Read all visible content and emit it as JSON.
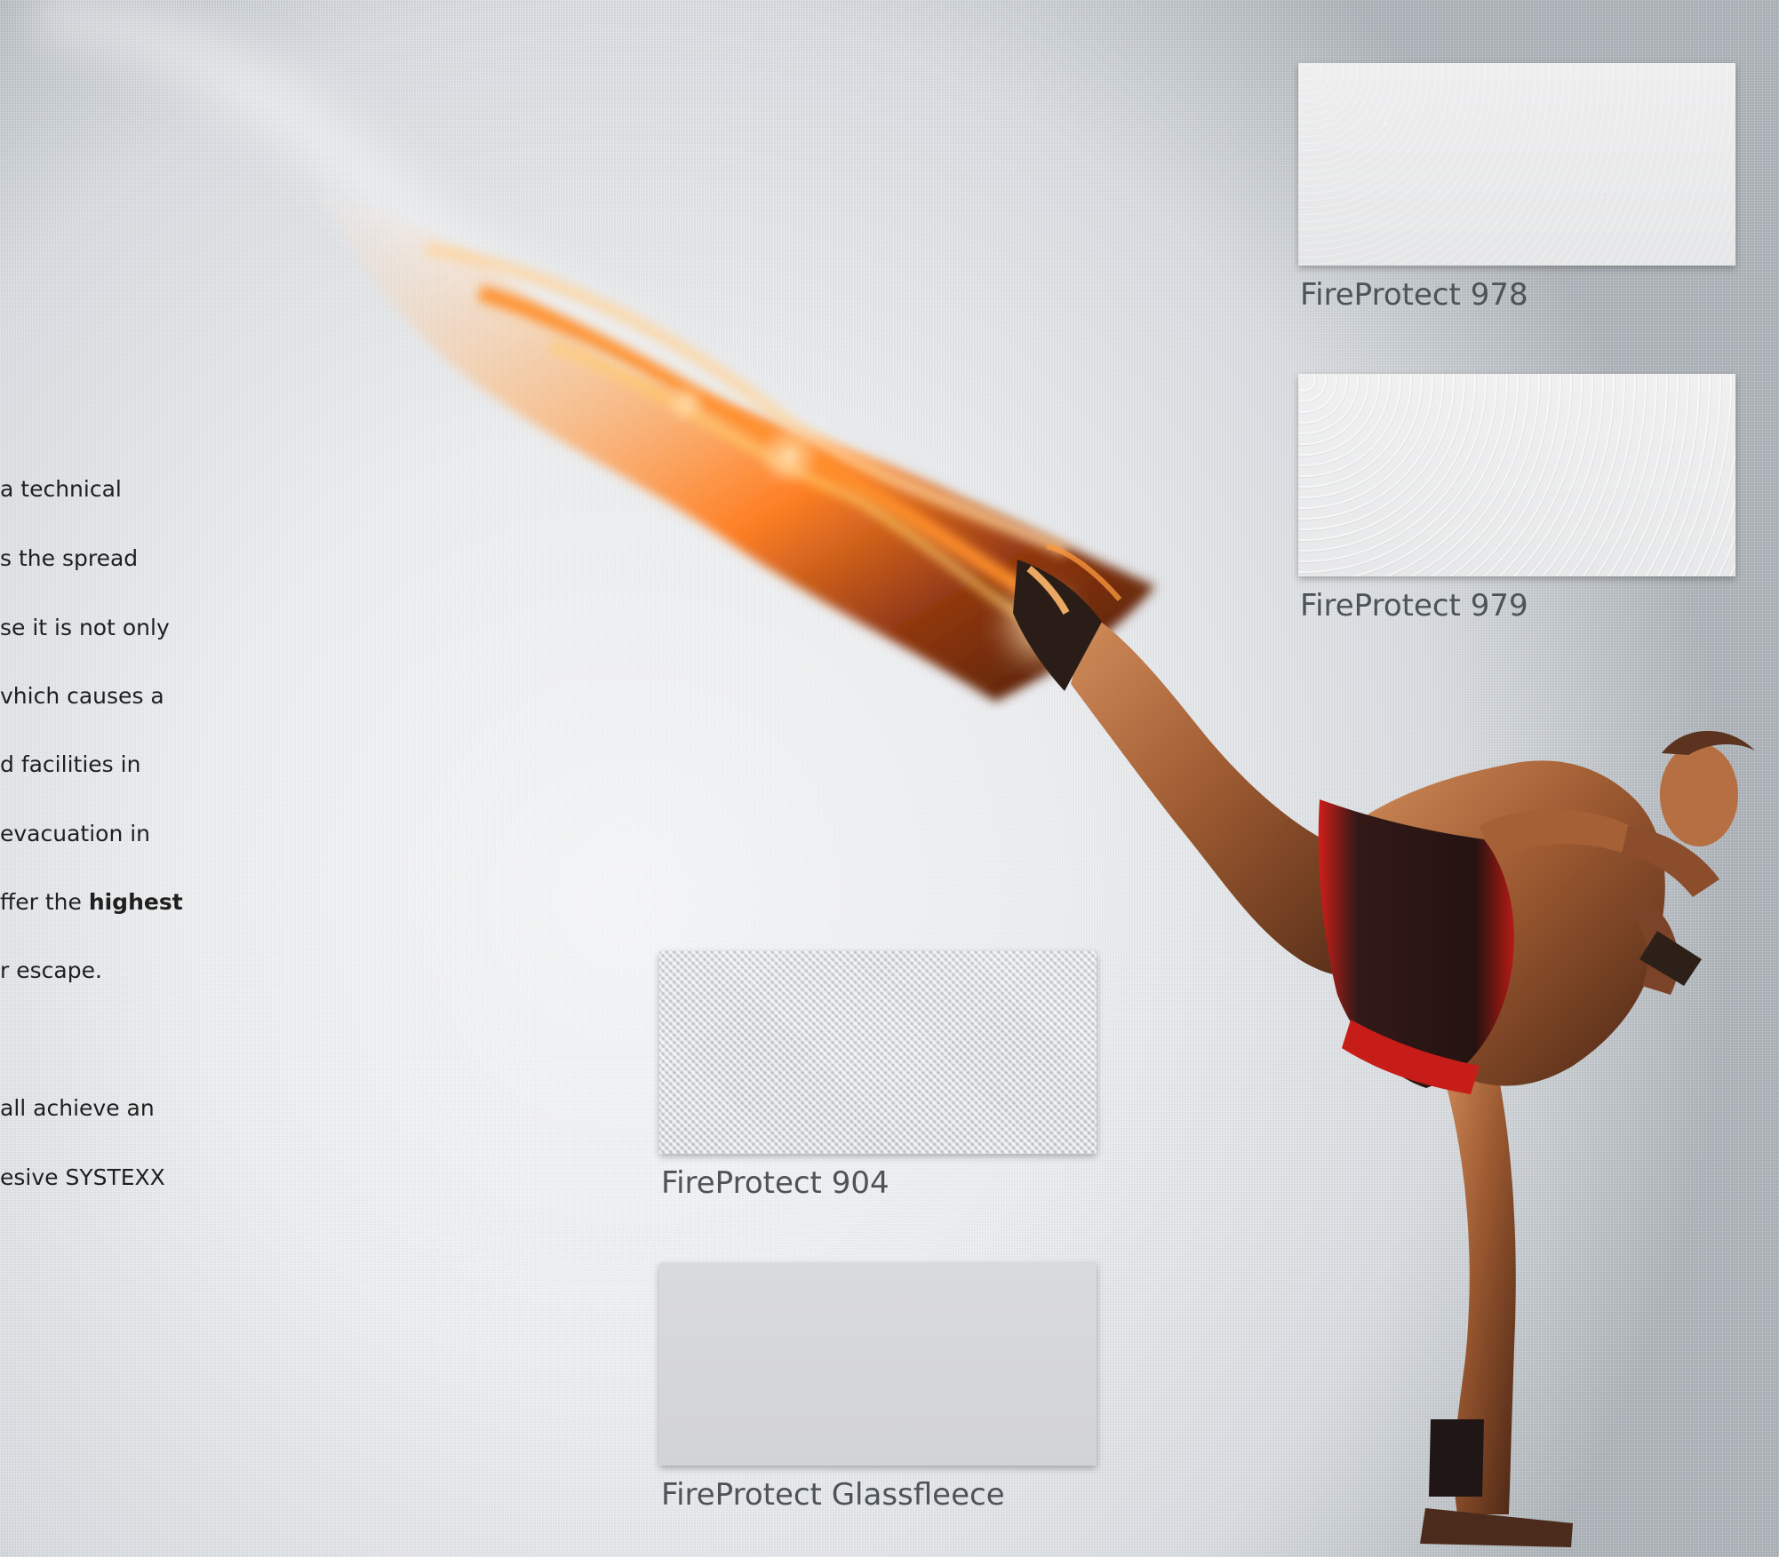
{
  "body_text_lines": [
    "a technical",
    "s the spread",
    "se it is not only",
    "vhich causes a",
    "d facilities in",
    "evacuation in",
    "ffer the ",
    "highest",
    "r escape.",
    "all achieve an",
    "esive SYSTEXX"
  ],
  "swatches": {
    "fp978": {
      "label": "FireProtect 978"
    },
    "fp979": {
      "label": "FireProtect 979"
    },
    "fp904": {
      "label": "FireProtect 904"
    },
    "glassfleece": {
      "label": "FireProtect Glassfleece"
    }
  }
}
